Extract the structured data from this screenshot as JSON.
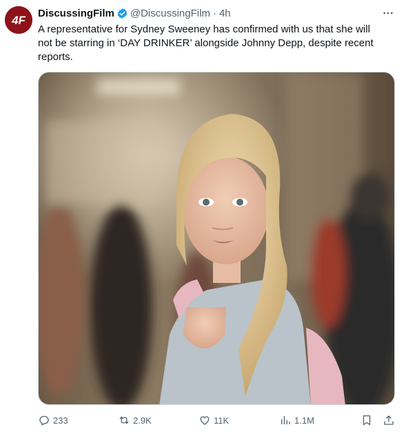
{
  "account": {
    "name": "DiscussingFilm",
    "handle": "@DiscussingFilm",
    "separator": "·",
    "time": "4h",
    "avatar_letters": "4F",
    "avatar_color": "#8e1219",
    "verified_color": "#1d9bf0"
  },
  "tweet": {
    "text": "A representative for Sydney Sweeney has confirmed with us that she will not be starring in ‘DAY DRINKER’ alongside Johnny Depp, despite recent reports."
  },
  "media": {
    "alt_subject": "photo"
  },
  "actions": {
    "replies": "233",
    "reposts": "2.9K",
    "likes": "11K",
    "views": "1.1M"
  },
  "icons": {
    "reply": "reply-icon",
    "repost": "repost-icon",
    "like": "heart-icon",
    "views": "views-chart-icon",
    "bookmark": "bookmark-icon",
    "share": "share-icon",
    "more": "more-dots-icon",
    "verified": "verified-badge-icon"
  }
}
